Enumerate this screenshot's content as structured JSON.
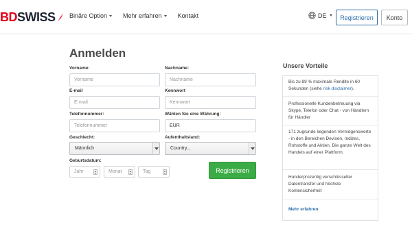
{
  "header": {
    "logo_text_bd": "BD",
    "logo_text_swiss": "SWISS",
    "nav": [
      {
        "label": "Binäre Option",
        "dropdown": true
      },
      {
        "label": "Mehr erfahren",
        "dropdown": true
      },
      {
        "label": "Kontakt",
        "dropdown": false
      }
    ],
    "language": "DE",
    "register_label": "Registrieren",
    "account_label": "Konto"
  },
  "form": {
    "title": "Anmelden",
    "first_name": {
      "label": "Vorname:",
      "placeholder": "Vorname"
    },
    "last_name": {
      "label": "Nachname:",
      "placeholder": "Nachname"
    },
    "email": {
      "label": "E-mail",
      "placeholder": "E-mail"
    },
    "password": {
      "label": "Kennwort",
      "placeholder": "Kennwort"
    },
    "phone": {
      "label": "Telefonnummer:",
      "placeholder": "Telefonnummer"
    },
    "currency": {
      "label": "Wählen Sie eine Währung:",
      "value": "EUR"
    },
    "gender": {
      "label": "Geschlecht:",
      "value": "Männlich"
    },
    "country": {
      "label": "Aufenthaltsland:",
      "value": "Country..."
    },
    "birthdate": {
      "label": "Geburtsdatum:",
      "year": "Jahr",
      "month": "Monat",
      "day": "Tag"
    },
    "submit_label": "Registrieren"
  },
  "advantages": {
    "title": "Unsere Vorteile",
    "item1_text": "Bis zu 89 % maximale Rendite in 60 Sekunden (siehe ",
    "item1_link": "risk disclaimer",
    "item1_end": ").",
    "item2": "Professionelle Kundenbetreuung via Skype, Telefon oder Chat - von Händlern für Händler",
    "item3": "171 zugrunde liegenden Vermögenswerte - in den Bereichen Devisen, Indizes, Rohstoffe und Aktien. Die ganze Welt des Handels auf einer Plattform.",
    "item4": "Hunderprozentig verschlüsselter Datentransfer und höchste Kontensicherheit",
    "more_label": "Mehr erfahren"
  },
  "colors": {
    "brand_red": "#e3001b",
    "primary_blue": "#2a6da9",
    "submit_green": "#3bab45"
  }
}
